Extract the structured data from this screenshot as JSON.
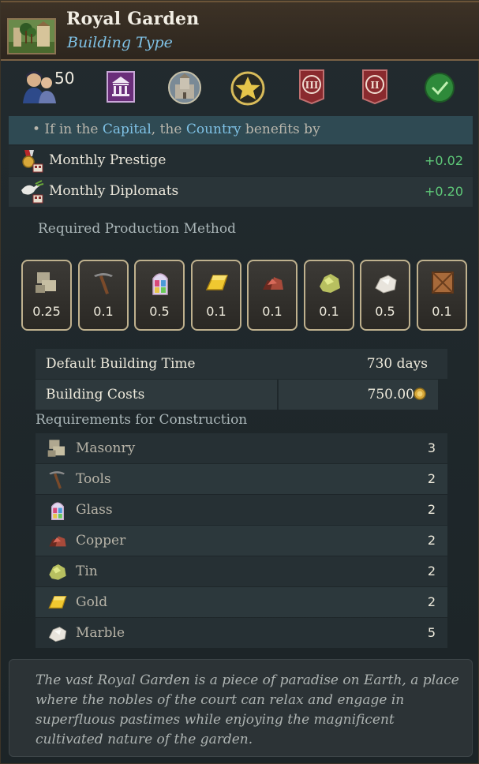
{
  "header": {
    "title": "Royal Garden",
    "subtitle": "Building Type",
    "icon": "garden-building-icon"
  },
  "icon_row": {
    "population_value": "50",
    "icons": [
      "population-icon",
      "noble-estate-icon",
      "castle-icon",
      "star-icon",
      "tier-3-banner-icon",
      "tier-2-banner-icon",
      "checkmark-icon"
    ]
  },
  "capital_info": {
    "prefix": "• If in the ",
    "capital": "Capital",
    "middle": ", the ",
    "country": "Country",
    "suffix": " benefits by"
  },
  "modifiers": [
    {
      "label": "Monthly Prestige",
      "value": "+0.02",
      "icon": "prestige-medal-icon"
    },
    {
      "label": "Monthly Diplomats",
      "value": "+0.20",
      "icon": "dove-diplomat-icon"
    }
  ],
  "production": {
    "label": "Required Production Method",
    "goods": [
      {
        "icon": "masonry-icon",
        "value": "0.25"
      },
      {
        "icon": "tools-icon",
        "value": "0.1"
      },
      {
        "icon": "glass-icon",
        "value": "0.5"
      },
      {
        "icon": "gold-icon",
        "value": "0.1"
      },
      {
        "icon": "copper-icon",
        "value": "0.1"
      },
      {
        "icon": "tin-icon",
        "value": "0.1"
      },
      {
        "icon": "marble-icon",
        "value": "0.5"
      },
      {
        "icon": "crate-icon",
        "value": "0.1"
      }
    ]
  },
  "stats": {
    "build_time_label": "Default Building Time",
    "build_time_value": "730 days",
    "cost_label": "Building Costs",
    "cost_value": "750.00"
  },
  "requirements": {
    "title": "Requirements for Construction",
    "items": [
      {
        "label": "Masonry",
        "value": "3",
        "icon": "masonry-icon"
      },
      {
        "label": "Tools",
        "value": "2",
        "icon": "tools-icon"
      },
      {
        "label": "Glass",
        "value": "2",
        "icon": "glass-icon"
      },
      {
        "label": "Copper",
        "value": "2",
        "icon": "copper-icon"
      },
      {
        "label": "Tin",
        "value": "2",
        "icon": "tin-icon"
      },
      {
        "label": "Gold",
        "value": "2",
        "icon": "gold-icon"
      },
      {
        "label": "Marble",
        "value": "5",
        "icon": "marble-icon"
      }
    ]
  },
  "description": "The vast Royal Garden is a piece of paradise on Earth, a place where the nobles of the court can relax and engage in superfluous pastimes while enjoying the magnificent cultivated nature of the garden.",
  "colors": {
    "positive": "#5ec878",
    "highlight": "#7fc2e6",
    "card_border": "#bfb18e"
  }
}
